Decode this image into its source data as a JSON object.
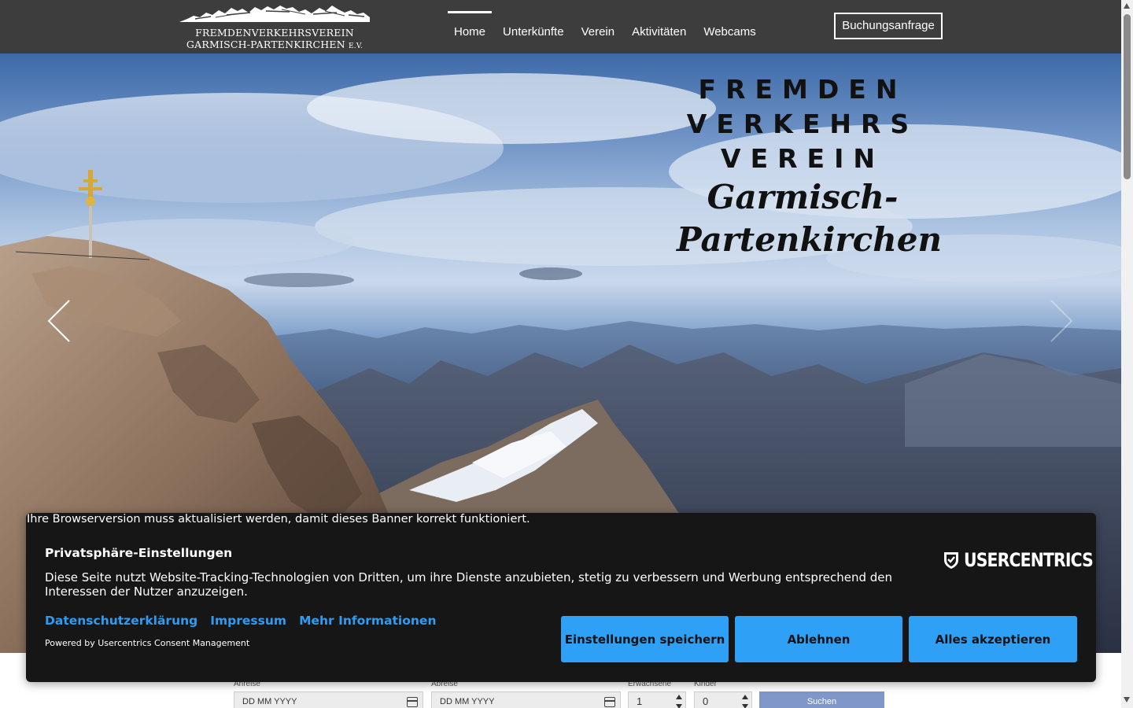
{
  "header": {
    "logo_line1": "FREMDENVERKEHRSVEREIN",
    "logo_line2": "GARMISCH-PARTENKIRCHEN",
    "logo_suffix": "E.V.",
    "nav": [
      {
        "label": "Home",
        "active": true
      },
      {
        "label": "Unterkünfte",
        "active": false
      },
      {
        "label": "Verein",
        "active": false
      },
      {
        "label": "Aktivitäten",
        "active": false
      },
      {
        "label": "Webcams",
        "active": false
      }
    ],
    "booking_button": "Buchungsanfrage"
  },
  "hero": {
    "title_words": [
      "FREMDEN",
      "VERKEHRS",
      "VEREIN"
    ],
    "title_script_1": "Garmisch-",
    "title_script_2": "Partenkirchen",
    "prev_icon": "chevron-left-icon",
    "next_icon": "chevron-right-icon"
  },
  "search_form": {
    "arrival_label": "Anreise",
    "arrival_placeholder": "DD MM YYYY",
    "departure_label": "Abreise",
    "departure_placeholder": "DD MM YYYY",
    "adults_label": "Erwachsene",
    "adults_value": "1",
    "children_label": "Kinder",
    "children_value": "0",
    "search_button": "Suchen"
  },
  "consent": {
    "browser_warning": "Ihre Browserversion muss aktualisiert werden, damit dieses Banner korrekt funktioniert.",
    "title": "Privatsphäre-Einstellungen",
    "text": "Diese Seite nutzt Website-Tracking-Technologien von Dritten, um ihre Dienste anzubieten, stetig zu verbessern und Werbung entsprechend den Interessen der Nutzer anzuzeigen.",
    "links": [
      "Datenschutzerklärung",
      "Impressum",
      "Mehr Informationen"
    ],
    "powered_by": "Powered by Usercentrics Consent Management",
    "brand": "USERCENTRICS",
    "buttons": {
      "save": "Einstellungen speichern",
      "deny": "Ablehnen",
      "accept": "Alles akzeptieren"
    },
    "colors": {
      "accent": "#2ea0f6",
      "background": "#161616"
    }
  }
}
